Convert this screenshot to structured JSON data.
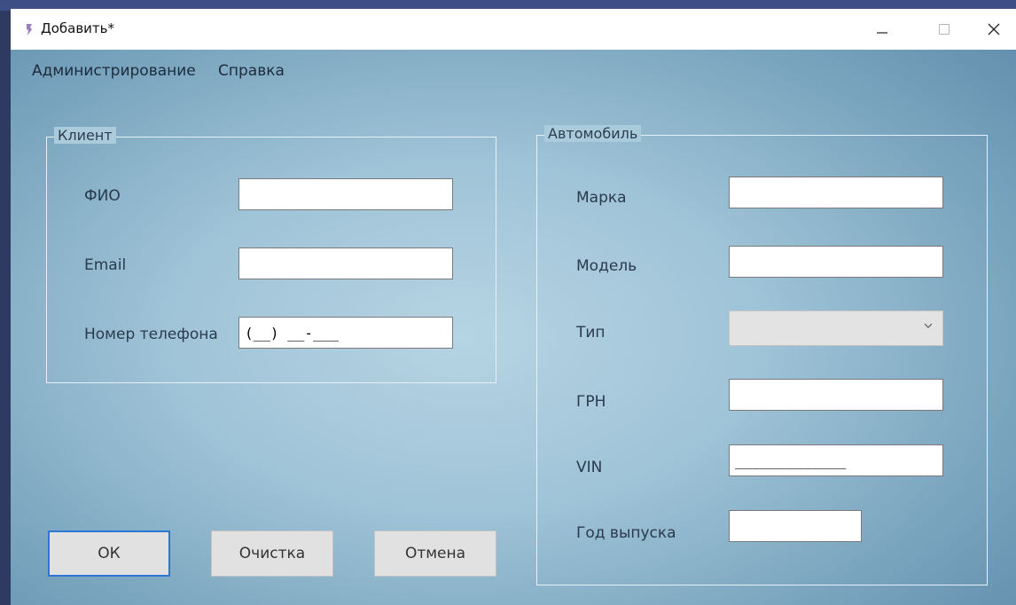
{
  "window": {
    "title": "Добавить*"
  },
  "menu": [
    "Администрирование",
    "Справка"
  ],
  "client_group": {
    "legend": "Клиент",
    "fields": [
      {
        "label": "ФИО",
        "value": ""
      },
      {
        "label": "Email",
        "value": ""
      },
      {
        "label": "Номер телефона",
        "value": "(__) __-___"
      }
    ]
  },
  "car_group": {
    "legend": "Автомобиль",
    "make": {
      "label": "Марка",
      "value": ""
    },
    "model": {
      "label": "Модель",
      "value": ""
    },
    "type": {
      "label": "Тип",
      "value": ""
    },
    "grn": {
      "label": "ГРН",
      "value": ""
    },
    "vin": {
      "label": "VIN",
      "value": "_____________"
    },
    "year": {
      "label": "Год выпуска",
      "value": ""
    }
  },
  "buttons": {
    "ok": "ОК",
    "clear": "Очистка",
    "cancel": "Отмена"
  },
  "colors": {
    "accent": "#2a78d4",
    "window_bg": "#9fc3d7",
    "titlebar": "#ffffff"
  }
}
